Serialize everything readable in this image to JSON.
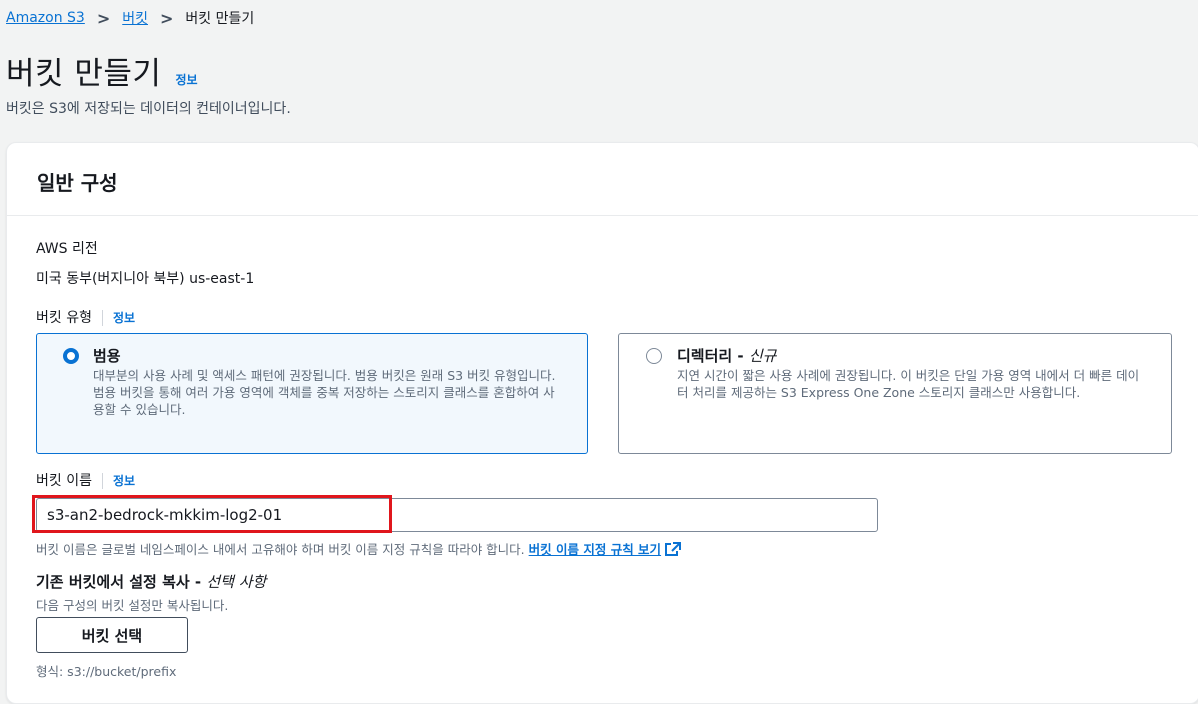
{
  "breadcrumb": {
    "items": [
      "Amazon S3",
      "버킷",
      "버킷 만들기"
    ]
  },
  "page": {
    "title": "버킷 만들기",
    "info_link": "정보",
    "description": "버킷은 S3에 저장되는 데이터의 컨테이너입니다."
  },
  "general": {
    "title": "일반 구성",
    "region_label": "AWS 리전",
    "region_value": "미국 동부(버지니아 북부) us-east-1",
    "bucket_type_label": "버킷 유형",
    "bucket_type_info": "정보",
    "types": [
      {
        "title": "범용",
        "title_suffix": "",
        "desc": "대부분의 사용 사례 및 액세스 패턴에 권장됩니다. 범용 버킷은 원래 S3 버킷 유형입니다. 범용 버킷을 통해 여러 가용 영역에 객체를 중복 저장하는 스토리지 클래스를 혼합하여 사용할 수 있습니다.",
        "selected": true
      },
      {
        "title": "디렉터리 - ",
        "title_suffix": "신규",
        "desc": "지연 시간이 짧은 사용 사례에 권장됩니다. 이 버킷은 단일 가용 영역 내에서 더 빠른 데이터 처리를 제공하는 S3 Express One Zone 스토리지 클래스만 사용합니다.",
        "selected": false
      }
    ],
    "bucket_name_label": "버킷 이름",
    "bucket_name_info": "정보",
    "bucket_name_value": "s3-an2-bedrock-mkkim-log2-01",
    "bucket_name_hint": "버킷 이름은 글로벌 네임스페이스 내에서 고유해야 하며 버킷 이름 지정 규칙을 따라야 합니다.",
    "bucket_name_rules_link": "버킷 이름 지정 규칙 보기",
    "copy_label": "기존 버킷에서 설정 복사 - ",
    "copy_label_suffix": "선택 사항",
    "copy_desc": "다음 구성의 버킷 설정만 복사됩니다.",
    "choose_bucket_button": "버킷 선택",
    "format_hint": "형식: s3://bucket/prefix"
  },
  "colors": {
    "link": "#0972d3",
    "highlight": "#e0161c",
    "selected_bg": "#f2f8fd"
  }
}
